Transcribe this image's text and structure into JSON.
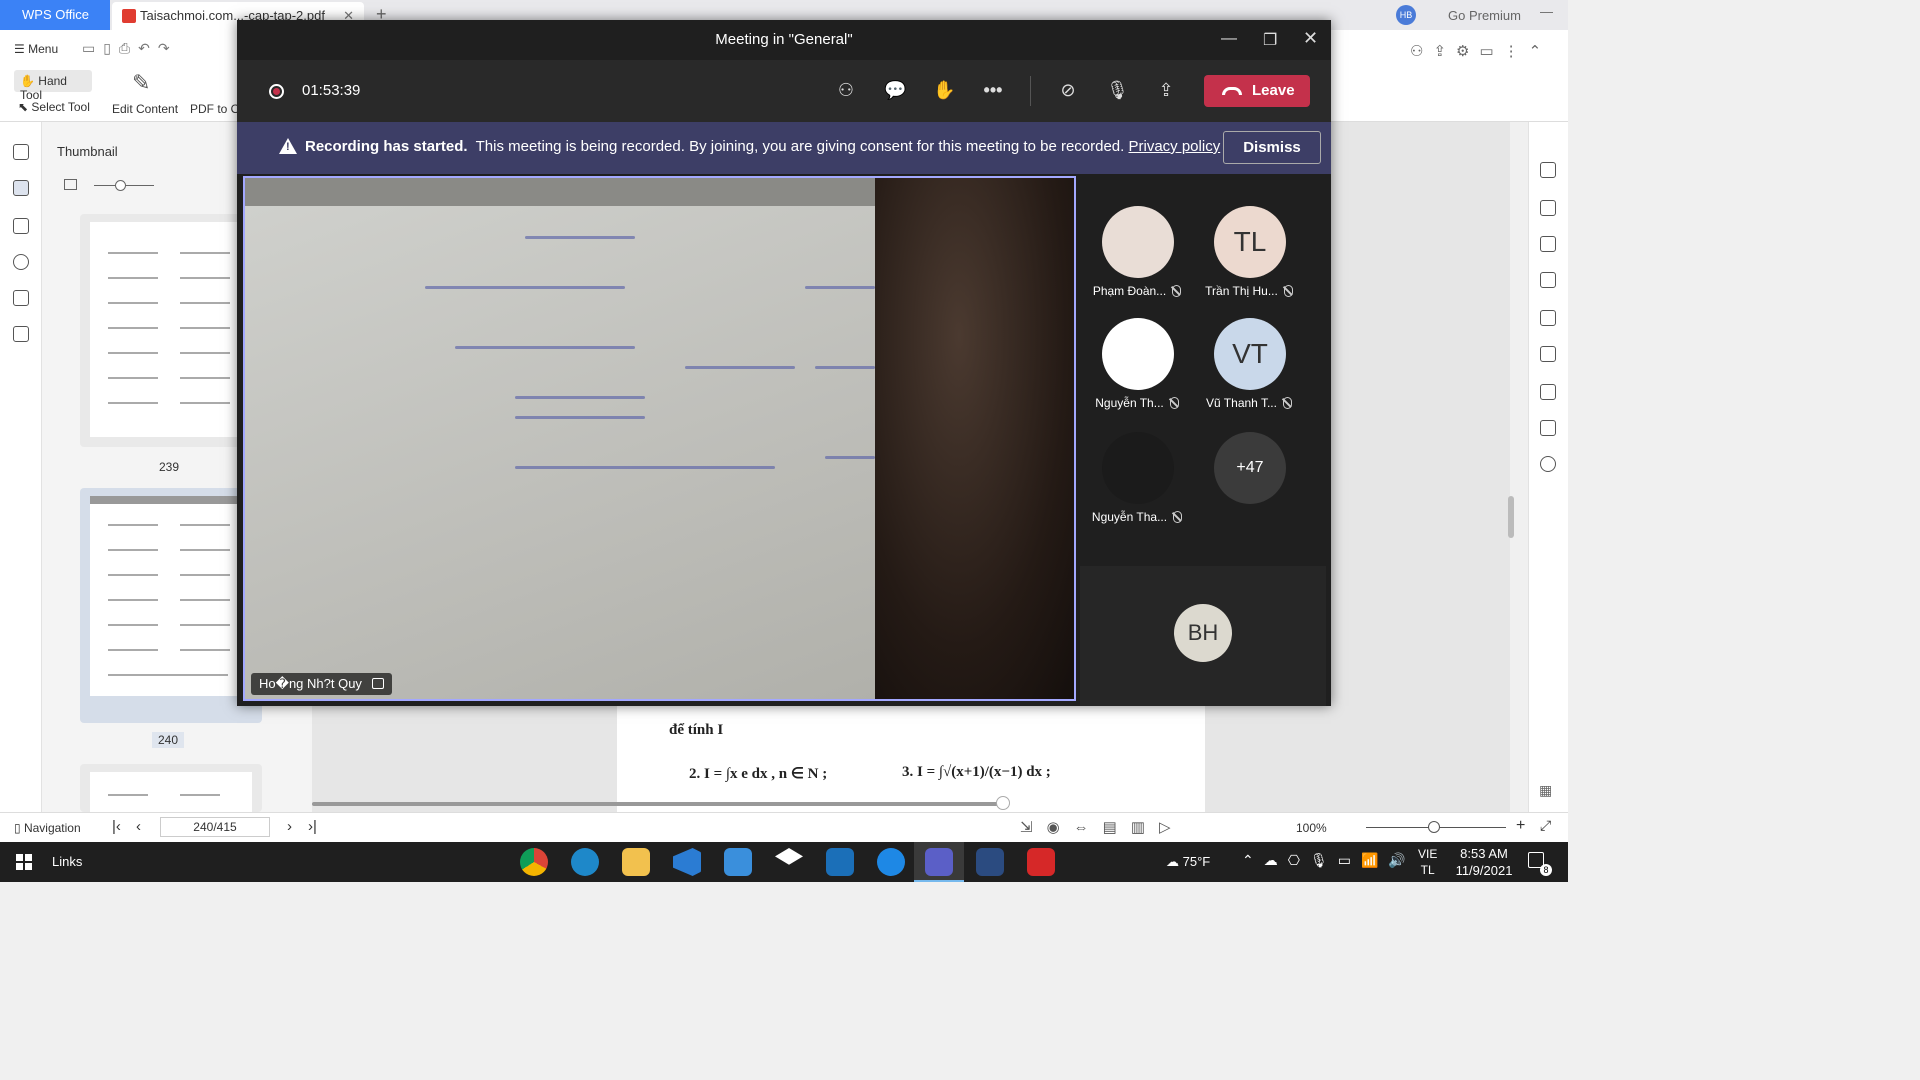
{
  "wps": {
    "home_tab": "WPS Office",
    "doc_tab": "Taisachmoi.com...-cap-tap-2.pdf",
    "go_premium": "Go Premium",
    "user_badge": "HB",
    "menu_label": "Menu",
    "hand_tool": "Hand Tool",
    "select_tool": "Select Tool",
    "edit_content": "Edit Content",
    "pdf_to": "PDF to Of",
    "thumbnail_title": "Thumbnail",
    "thumb_pages": [
      "239",
      "240"
    ],
    "doc_lines": [
      "để tính I",
      "2.  I  = ∫x e dx , n ∈ N ;",
      "3.  I = ∫√(x+1)/(x−1) dx ;"
    ],
    "navigation": "Navigation",
    "page_indicator": "240/415",
    "zoom": "100%"
  },
  "teams": {
    "window_title": "Meeting in \"General\"",
    "timer": "01:53:39",
    "leave_label": "Leave",
    "banner": {
      "bold": "Recording has started.",
      "text": "This meeting is being recorded. By joining, you are giving consent for this meeting to be recorded.",
      "link": "Privacy policy",
      "dismiss": "Dismiss"
    },
    "speaker_name": "Ho�ng Nh?t Quy",
    "participants": [
      {
        "name": "Phạm Đoàn...",
        "initials": "",
        "avatar_color": "#e9ddd6"
      },
      {
        "name": "Trần Thị Hu...",
        "initials": "TL",
        "avatar_color": "#ecd9cf"
      },
      {
        "name": "Nguyễn Th...",
        "initials": "",
        "avatar_color": "#ffffff"
      },
      {
        "name": "Vũ Thanh T...",
        "initials": "VT",
        "avatar_color": "#c9d8ea"
      },
      {
        "name": "Nguyễn Tha...",
        "initials": "",
        "avatar_color": "#1b1b1b"
      },
      {
        "name": "",
        "initials": "+47",
        "avatar_color": "#3b3b3b"
      }
    ],
    "self_initials": "BH"
  },
  "taskbar": {
    "links": "Links",
    "weather": "75°F",
    "lang1": "VIE",
    "lang2": "TL",
    "time": "8:53 AM",
    "date": "11/9/2021",
    "notif_count": "8"
  }
}
